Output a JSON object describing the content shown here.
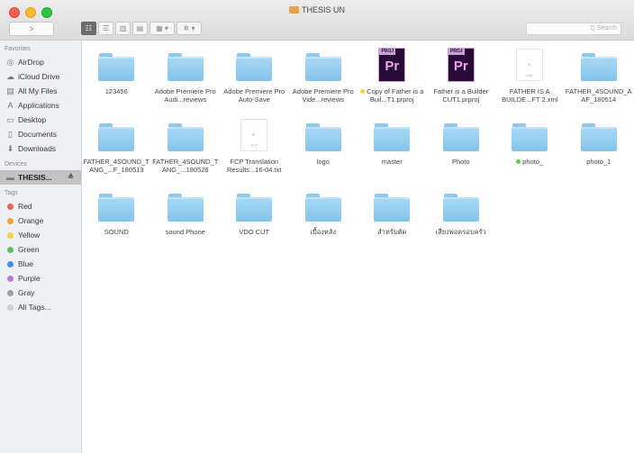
{
  "window": {
    "title": "THESIS UN"
  },
  "toolbar": {
    "nav_label": ">",
    "view_buttons": [
      "☷",
      "☰",
      "▥",
      "▤"
    ],
    "arrange_label": "▦ ▾",
    "action_label": "✲ ▾",
    "search_placeholder": "Q Search"
  },
  "sidebar": {
    "favorites_header": "Favorites",
    "favorites": [
      {
        "label": "AirDrop",
        "icon": "airdrop-icon",
        "glyph": "◎"
      },
      {
        "label": "iCloud Drive",
        "icon": "cloud-icon",
        "glyph": "☁"
      },
      {
        "label": "All My Files",
        "icon": "files-icon",
        "glyph": "▤"
      },
      {
        "label": "Applications",
        "icon": "applications-icon",
        "glyph": "A"
      },
      {
        "label": "Desktop",
        "icon": "desktop-icon",
        "glyph": "▭"
      },
      {
        "label": "Documents",
        "icon": "documents-icon",
        "glyph": "▯"
      },
      {
        "label": "Downloads",
        "icon": "downloads-icon",
        "glyph": "⬇"
      }
    ],
    "devices_header": "Devices",
    "devices": [
      {
        "label": "THESIS...",
        "icon": "drive-icon",
        "glyph": "▬",
        "eject": "≜"
      }
    ],
    "tags_header": "Tags",
    "tags": [
      {
        "label": "Red",
        "color": "#f2635b"
      },
      {
        "label": "Orange",
        "color": "#f6a33c"
      },
      {
        "label": "Yellow",
        "color": "#f5d23f"
      },
      {
        "label": "Green",
        "color": "#5bc45a"
      },
      {
        "label": "Blue",
        "color": "#3d8ef3"
      },
      {
        "label": "Purple",
        "color": "#b47ad6"
      },
      {
        "label": "Gray",
        "color": "#a0a0a0"
      },
      {
        "label": "All Tags...",
        "color": "#cfcfcf"
      }
    ]
  },
  "files": [
    [
      {
        "name": "123456",
        "kind": "folder"
      },
      {
        "name": "Adobe Premiere Pro Audi...reviews",
        "kind": "folder"
      },
      {
        "name": "Adobe Premiere Pro Auto-Save",
        "kind": "folder"
      },
      {
        "name": "Adobe Premiere Pro Vide...reviews",
        "kind": "folder"
      },
      {
        "name": "Copy of Father is a Buil...T1.prproj",
        "kind": "premiere",
        "tag": "#f5d23f"
      },
      {
        "name": "Father is a Builder CUT1.prproj",
        "kind": "premiere"
      },
      {
        "name": "FATHER IS A BUILDE...FT 2.xml",
        "kind": "document",
        "ext": "XML"
      },
      {
        "name": "FATHER_4SOUND_AAF_180514",
        "kind": "folder"
      }
    ],
    [
      {
        "name": "FATHER_4SOUND_TANG_...F_180513",
        "kind": "folder"
      },
      {
        "name": "FATHER_4SOUND_TANG_...180526",
        "kind": "folder"
      },
      {
        "name": "FCP Translation Results...16-04.txt",
        "kind": "document",
        "ext": "TXT"
      },
      {
        "name": "logo",
        "kind": "folder"
      },
      {
        "name": "master",
        "kind": "folder"
      },
      {
        "name": "Photo",
        "kind": "folder"
      },
      {
        "name": "photo_",
        "kind": "folder",
        "tag": "#5bc45a"
      },
      {
        "name": "photo_1",
        "kind": "folder"
      }
    ],
    [
      {
        "name": "SOUND",
        "kind": "folder"
      },
      {
        "name": "sound Phone",
        "kind": "folder"
      },
      {
        "name": "VDO CUT",
        "kind": "folder"
      },
      {
        "name": "เบื้องหลัง",
        "kind": "folder"
      },
      {
        "name": "สำหรับตัด",
        "kind": "folder"
      },
      {
        "name": "เสียงพ่อครอบครัว",
        "kind": "folder"
      }
    ]
  ],
  "premiere_badge": {
    "band": "PROJ",
    "letters": "Pr"
  }
}
